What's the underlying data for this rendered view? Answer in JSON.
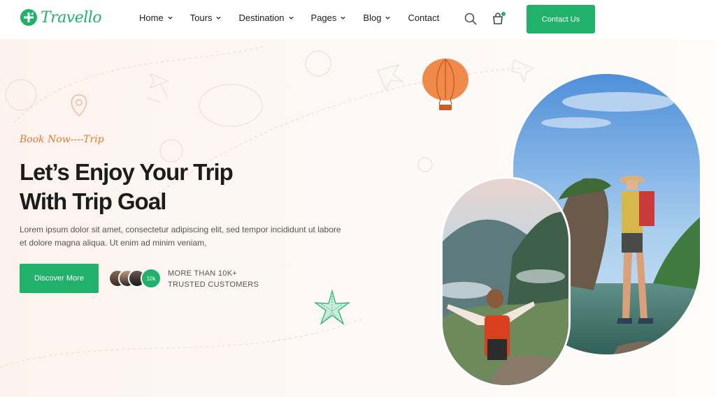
{
  "brand": {
    "name": "Travello",
    "color": "#22b16b"
  },
  "nav": {
    "items": [
      {
        "label": "Home",
        "has_dropdown": true
      },
      {
        "label": "Tours",
        "has_dropdown": true
      },
      {
        "label": "Destination",
        "has_dropdown": true
      },
      {
        "label": "Pages",
        "has_dropdown": true
      },
      {
        "label": "Blog",
        "has_dropdown": true
      },
      {
        "label": "Contact",
        "has_dropdown": false
      }
    ],
    "icons": [
      "search-icon",
      "cart-icon"
    ],
    "contact_button": "Contact Us"
  },
  "hero": {
    "tagline": "Book Now----Trip",
    "title_line1": "Let’s Enjoy Your Trip",
    "title_line2": "With Trip Goal",
    "description": "Lorem ipsum dolor sit amet, consectetur adipiscing elit, sed tempor incididunt ut labore et dolore magna aliqua. Ut enim ad minim veniam,",
    "cta_button": "Discover More",
    "customers_badge": "10k",
    "customers_line1": "MORE THAN 10K+",
    "customers_line2": "TRUSTED CUSTOMERS"
  },
  "colors": {
    "accent": "#22b16b",
    "tagline": "#e07a3a",
    "hero_bg": "#fdf5f0"
  }
}
